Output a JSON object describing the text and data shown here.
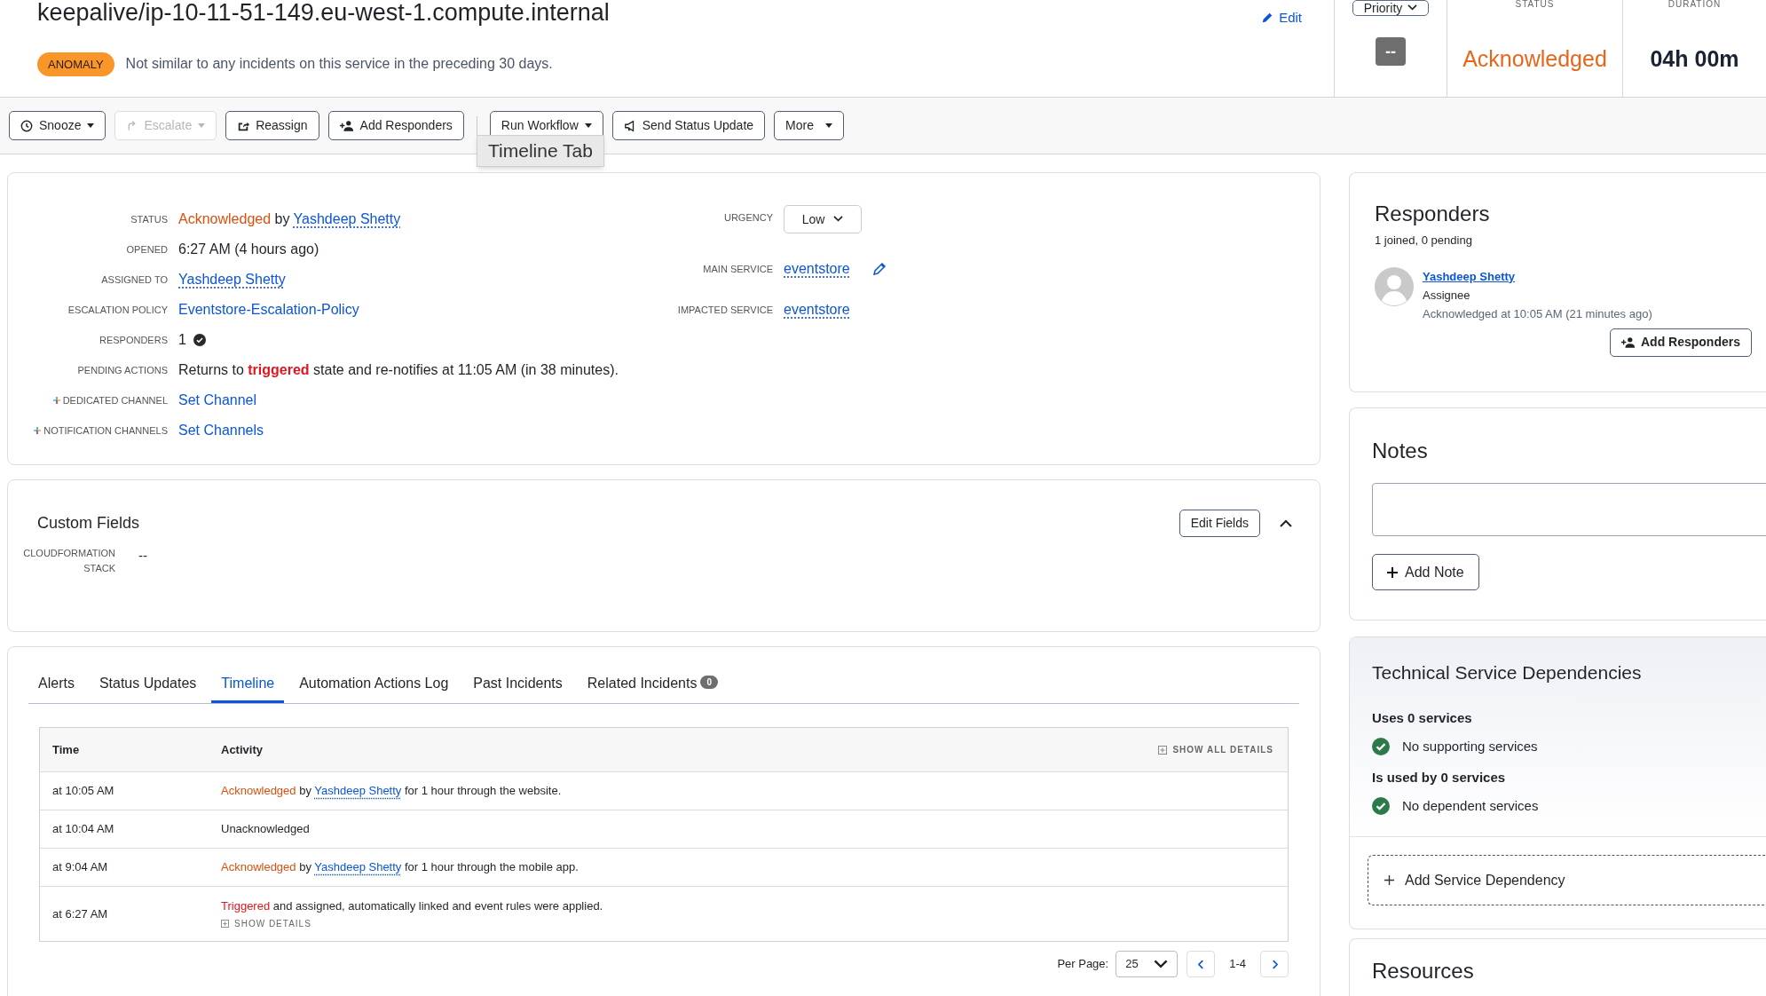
{
  "header": {
    "title": "keepalive/ip-10-11-51-149.eu-west-1.compute.internal",
    "badge": "ANOMALY",
    "note": "Not similar to any incidents on this service in the preceding 30 days.",
    "edit": "Edit"
  },
  "priority": {
    "dropdown": "Priority",
    "value": "--"
  },
  "status_summary": {
    "label": "STATUS",
    "value": "Acknowledged"
  },
  "duration": {
    "label": "DURATION",
    "value": "04h 00m"
  },
  "toolbar": [
    {
      "kind": "snooze",
      "label": "Snooze",
      "disabled": false
    },
    {
      "kind": "escalate",
      "label": "Escalate",
      "disabled": true
    },
    {
      "kind": "reassign",
      "label": "Reassign",
      "disabled": false
    },
    {
      "kind": "responders",
      "label": "Add Responders",
      "disabled": false
    },
    {
      "kind": "workflow",
      "label": "Run Workflow",
      "disabled": false
    },
    {
      "kind": "update",
      "label": "Send Status Update",
      "disabled": false
    },
    {
      "kind": "more",
      "label": "More",
      "disabled": false
    }
  ],
  "tooltip": "Timeline Tab",
  "details": {
    "rows": [
      {
        "label": "STATUS",
        "segments": [
          {
            "kind": "status",
            "text": "Acknowledged"
          },
          {
            "kind": "plain",
            "text": " by "
          },
          {
            "kind": "link",
            "text": "Yashdeep Shetty"
          }
        ]
      },
      {
        "label": "OPENED",
        "segments": [
          {
            "kind": "plain",
            "text": "6:27 AM (4 hours ago)"
          }
        ]
      },
      {
        "label": "ASSIGNED TO",
        "segments": [
          {
            "kind": "link",
            "text": "Yashdeep Shetty"
          }
        ]
      },
      {
        "label": "ESCALATION POLICY",
        "segments": [
          {
            "kind": "action",
            "text": "Eventstore-Escalation-Policy"
          }
        ]
      },
      {
        "label": "RESPONDERS",
        "segments": [
          {
            "kind": "plain",
            "text": "1"
          }
        ],
        "verified": true
      },
      {
        "label": "PENDING ACTIONS",
        "segments": [
          {
            "kind": "plain",
            "text": "Returns to "
          },
          {
            "kind": "alert",
            "text": "triggered"
          },
          {
            "kind": "plain",
            "text": " state and re-notifies at 11:05 AM (in 38 minutes)."
          }
        ]
      },
      {
        "label": "DEDICATED CHANNEL",
        "channel_icon": true,
        "segments": [
          {
            "kind": "action",
            "text": "Set Channel"
          }
        ]
      },
      {
        "label": "NOTIFICATION CHANNELS",
        "channel_icon": true,
        "segments": [
          {
            "kind": "action",
            "text": "Set Channels"
          }
        ]
      }
    ],
    "urgency": {
      "label": "URGENCY",
      "value": "Low"
    },
    "services": [
      {
        "label": "MAIN SERVICE",
        "value": "eventstore",
        "editable": true
      },
      {
        "label": "IMPACTED SERVICE",
        "value": "eventstore",
        "editable": false
      }
    ]
  },
  "custom_fields": {
    "title": "Custom Fields",
    "button": "Edit Fields",
    "expanded": true,
    "fields": [
      {
        "label": "CLOUDFORMATION STACK",
        "value": "--"
      }
    ]
  },
  "tabs": [
    {
      "label": "Alerts",
      "selected": false
    },
    {
      "label": "Status Updates",
      "selected": false
    },
    {
      "label": "Timeline",
      "selected": true
    },
    {
      "label": "Automation Actions Log",
      "selected": false
    },
    {
      "label": "Past Incidents",
      "selected": false
    },
    {
      "label": "Related Incidents",
      "count": "0",
      "selected": false
    }
  ],
  "timeline": {
    "columns": [
      "Time",
      "Activity"
    ],
    "show_all": "SHOW ALL DETAILS",
    "rows": [
      {
        "time": "at 10:05 AM",
        "segments": [
          {
            "kind": "status",
            "text": "Acknowledged"
          },
          {
            "kind": "plain",
            "text": " by "
          },
          {
            "kind": "link",
            "text": "Yashdeep Shetty"
          },
          {
            "kind": "plain",
            "text": " for 1 hour through the website."
          }
        ]
      },
      {
        "time": "at 10:04 AM",
        "segments": [
          {
            "kind": "plain",
            "text": "Unacknowledged"
          }
        ]
      },
      {
        "time": "at 9:04 AM",
        "segments": [
          {
            "kind": "status",
            "text": "Acknowledged"
          },
          {
            "kind": "plain",
            "text": " by "
          },
          {
            "kind": "link",
            "text": "Yashdeep Shetty"
          },
          {
            "kind": "plain",
            "text": " for 1 hour through the mobile app."
          }
        ]
      },
      {
        "time": "at 6:27 AM",
        "segments": [
          {
            "kind": "trigger",
            "text": "Triggered"
          },
          {
            "kind": "plain",
            "text": " and assigned, automatically linked and event rules were applied."
          }
        ],
        "details": "SHOW DETAILS"
      }
    ]
  },
  "pagination": {
    "label": "Per Page:",
    "per_page": "25",
    "range": "1-4"
  },
  "responders": {
    "title": "Responders",
    "summary": "1 joined, 0 pending",
    "people": [
      {
        "name": "Yashdeep Shetty",
        "role": "Assignee",
        "note": "Acknowledged at 10:05 AM (21 minutes ago)"
      }
    ],
    "button": "Add Responders"
  },
  "notes": {
    "title": "Notes",
    "button": "Add Note"
  },
  "dependencies": {
    "title": "Technical Service Dependencies",
    "groups": [
      {
        "heading": "Uses 0 services",
        "item": "No supporting services"
      },
      {
        "heading": "Is used by 0 services",
        "item": "No dependent services"
      }
    ],
    "button": "Add Service Dependency"
  },
  "resources": {
    "title": "Resources"
  }
}
